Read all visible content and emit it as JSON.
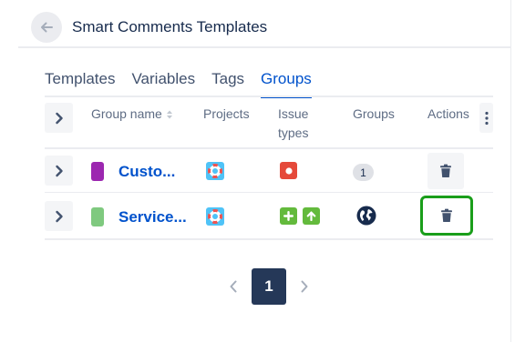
{
  "app": {
    "title": "Smart Comments Templates"
  },
  "tabs": [
    {
      "label": "Templates",
      "active": false
    },
    {
      "label": "Variables",
      "active": false
    },
    {
      "label": "Tags",
      "active": false
    },
    {
      "label": "Groups",
      "active": true
    }
  ],
  "table": {
    "columns": {
      "group_name": "Group name",
      "projects": "Projects",
      "issue_types_line1": "Issue",
      "issue_types_line2": "types",
      "groups": "Groups",
      "actions": "Actions"
    },
    "rows": [
      {
        "name": "Custo...",
        "color": "#9c27b0",
        "project_icon": "lifebuoy-icon",
        "issue_type_icons": [
          "bug-icon"
        ],
        "groups_count": "1",
        "groups_icon": null,
        "action_icon": "trash-icon"
      },
      {
        "name": "Service...",
        "color": "#7fc97f",
        "project_icon": "lifebuoy-icon",
        "issue_type_icons": [
          "new-feature-icon",
          "improvement-icon"
        ],
        "groups_count": null,
        "groups_icon": "globe-icon",
        "action_icon": "trash-icon"
      }
    ]
  },
  "pagination": {
    "current": "1"
  },
  "colors": {
    "accent": "#0052cc",
    "highlight": "#1a9e1a",
    "bug": "#e5493a",
    "new_feature": "#63ba3c",
    "pager_active": "#253858"
  }
}
